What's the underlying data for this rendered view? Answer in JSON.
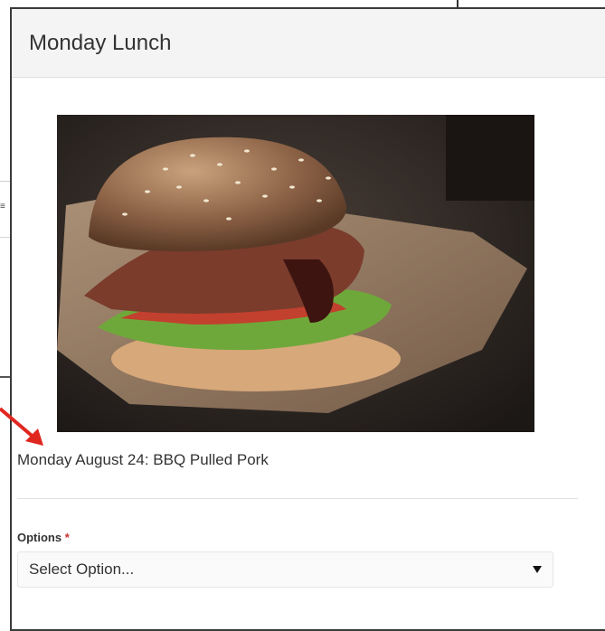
{
  "modal": {
    "title": "Monday Lunch",
    "image_alt": "BBQ pulled pork sandwich",
    "caption": "Monday August 24: BBQ Pulled Pork",
    "options": {
      "label": "Options",
      "required_marker": "*",
      "selected_value": "Select Option..."
    }
  },
  "colors": {
    "header_bg": "#f4f4f4",
    "required": "#c9302c",
    "annotation_arrow": "#e0271f"
  }
}
